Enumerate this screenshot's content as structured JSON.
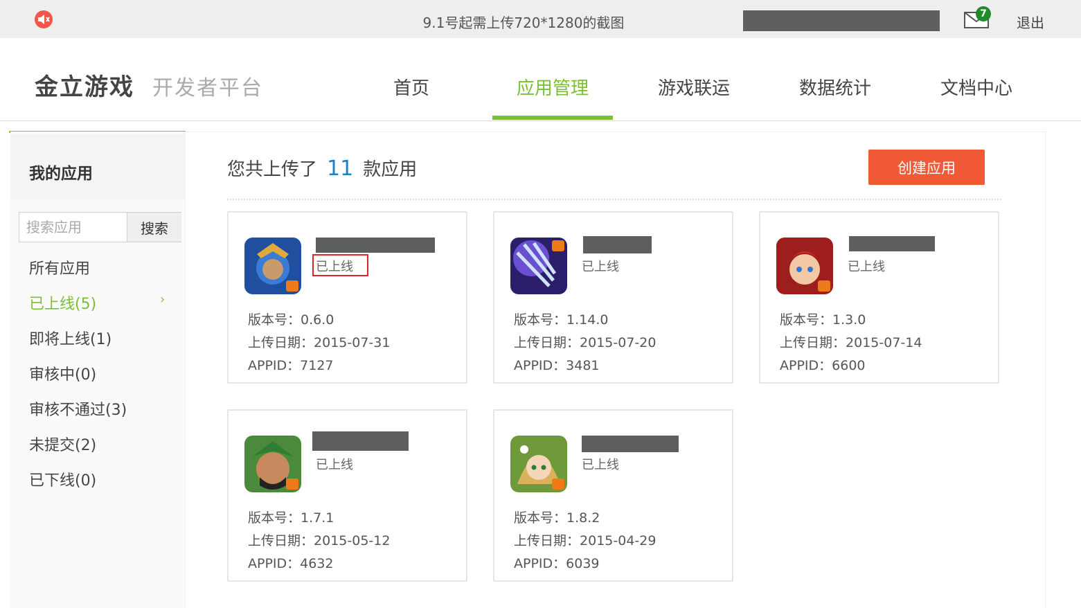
{
  "topbar": {
    "notice": "9.1号起需上传720*1280的截图",
    "mail_count": "7",
    "logout": "退出"
  },
  "header": {
    "logo": "金立游戏",
    "logo_sub": "开发者平台",
    "nav": [
      "首页",
      "应用管理",
      "游戏联运",
      "数据统计",
      "文档中心"
    ],
    "active_nav": "应用管理"
  },
  "sidebar": {
    "title": "我的应用",
    "search_placeholder": "搜索应用",
    "search_button": "搜索",
    "items": [
      "所有应用",
      "已上线(5)",
      "即将上线(1)",
      "审核中(0)",
      "审核不通过(3)",
      "未提交(2)",
      "已下线(0)"
    ],
    "active_item": "已上线(5)"
  },
  "main": {
    "summary_prefix": "您共上传了",
    "summary_count": "11",
    "summary_suffix": "款应用",
    "create_button": "创建应用",
    "version_label": "版本号：",
    "date_label": "上传日期：",
    "appid_label": "APPID：",
    "apps": [
      {
        "status": "已上线",
        "version": "0.6.0",
        "date": "2015-07-31",
        "appid": "7127",
        "icon": "warrior-game-icon"
      },
      {
        "status": "已上线",
        "version": "1.14.0",
        "date": "2015-07-20",
        "appid": "3481",
        "icon": "trident-game-icon"
      },
      {
        "status": "已上线",
        "version": "1.3.0",
        "date": "2015-07-14",
        "appid": "6600",
        "icon": "heroine-game-icon"
      },
      {
        "status": "已上线",
        "version": "1.7.1",
        "date": "2015-05-12",
        "appid": "4632",
        "icon": "general-game-icon"
      },
      {
        "status": "已上线",
        "version": "1.8.2",
        "date": "2015-04-29",
        "appid": "6039",
        "icon": "fairy-game-icon"
      }
    ]
  },
  "colors": {
    "accent": "#7bbf35",
    "create_button": "#f15a37",
    "count": "#1e80c6",
    "highlight_box": "#d9262b"
  }
}
